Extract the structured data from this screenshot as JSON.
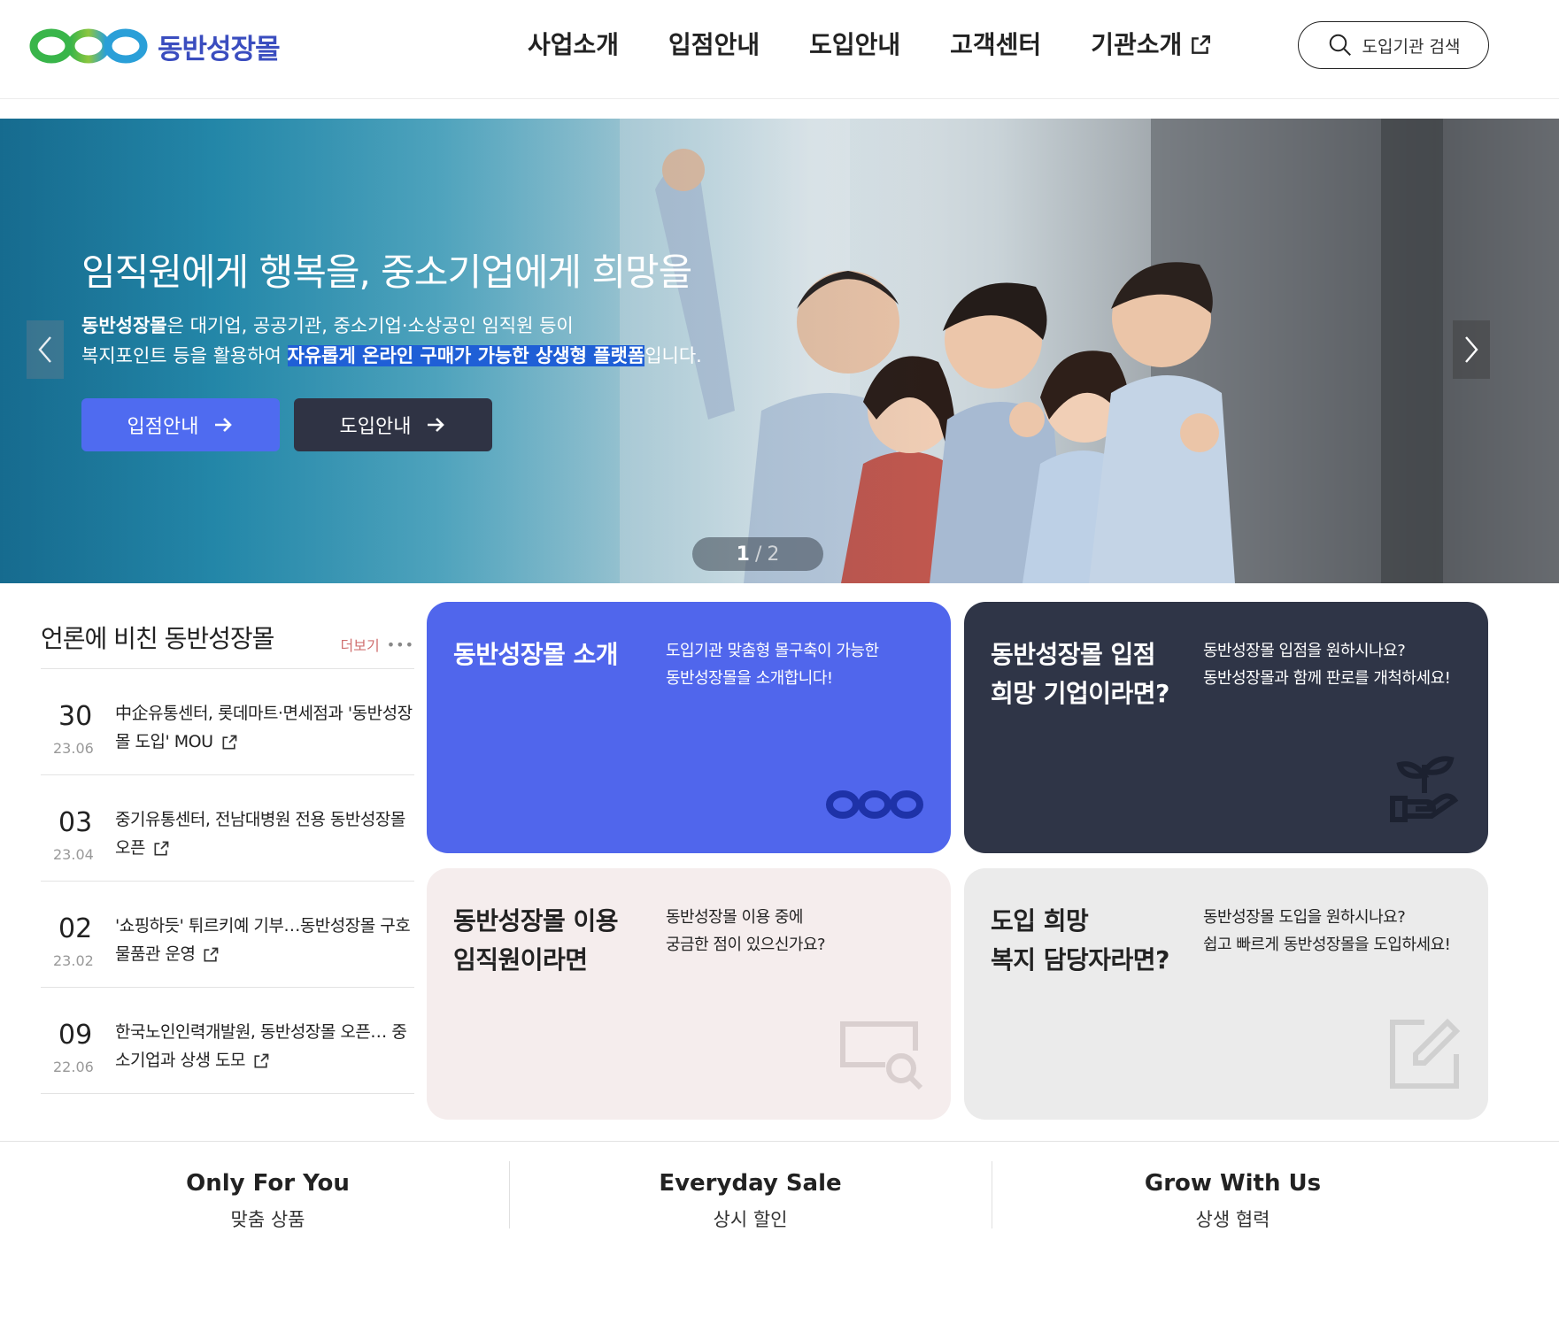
{
  "header": {
    "logo_text": "동반성장몰",
    "nav": [
      {
        "label": "사업소개"
      },
      {
        "label": "입점안내"
      },
      {
        "label": "도입안내"
      },
      {
        "label": "고객센터"
      },
      {
        "label": "기관소개"
      }
    ],
    "search_label": "도입기관 검색"
  },
  "hero": {
    "title": "임직원에게 행복을, 중소기업에게 희망을",
    "desc1_bold": "동반성장몰",
    "desc1_rest": "은 대기업, 공공기관, 중소기업·소상공인 임직원 등이",
    "desc2_pre": "복지포인트 등을 활용하여 ",
    "desc2_highlight": "자유롭게 온라인 구매가 가능한 상생형 플랫폼",
    "desc2_post": "입니다.",
    "btn_primary": "입점안내",
    "btn_secondary": "도입안내",
    "pager_current": "1",
    "pager_sep": "/",
    "pager_total": "2"
  },
  "press": {
    "title": "언론에 비친 동반성장몰",
    "more_label": "더보기",
    "items": [
      {
        "day": "30",
        "ym": "23.06",
        "text": "中企유통센터, 롯데마트·면세점과 '동반성장몰 도입' MOU"
      },
      {
        "day": "03",
        "ym": "23.04",
        "text": "중기유통센터, 전남대병원 전용 동반성장몰 오픈"
      },
      {
        "day": "02",
        "ym": "23.02",
        "text": "'쇼핑하듯' 튀르키예 기부…동반성장몰 구호물품관 운영"
      },
      {
        "day": "09",
        "ym": "22.06",
        "text": "한국노인인력개발원, 동반성장몰 오픈… 중소기업과 상생 도모"
      }
    ]
  },
  "cards": [
    {
      "title1": "동반성장몰 소개",
      "title2": "",
      "desc1": "도입기관 맞춤형 몰구축이 가능한",
      "desc2": "동반성장몰을 소개합니다!"
    },
    {
      "title1": "동반성장몰 입점",
      "title2": "희망 기업이라면?",
      "desc1": "동반성장몰 입점을 원하시나요?",
      "desc2": "동반성장몰과 함께 판로를 개척하세요!"
    },
    {
      "title1": "동반성장몰 이용",
      "title2": "임직원이라면",
      "desc1": "동반성장몰 이용 중에",
      "desc2": "궁금한 점이 있으신가요?"
    },
    {
      "title1": "도입 희망",
      "title2": "복지 담당자라면?",
      "desc1": "동반성장몰 도입을 원하시나요?",
      "desc2": "쉽고 빠르게 동반성장몰을 도입하세요!"
    }
  ],
  "features": [
    {
      "en": "Only For You",
      "ko": "맞춤 상품"
    },
    {
      "en": "Everyday Sale",
      "ko": "상시 할인"
    },
    {
      "en": "Grow With Us",
      "ko": "상생 협력"
    }
  ],
  "colors": {
    "brand_blue": "#5066ec",
    "dark_navy": "#2f3547",
    "logo_green": "#39b54a",
    "logo_blue": "#2a9fd8"
  }
}
